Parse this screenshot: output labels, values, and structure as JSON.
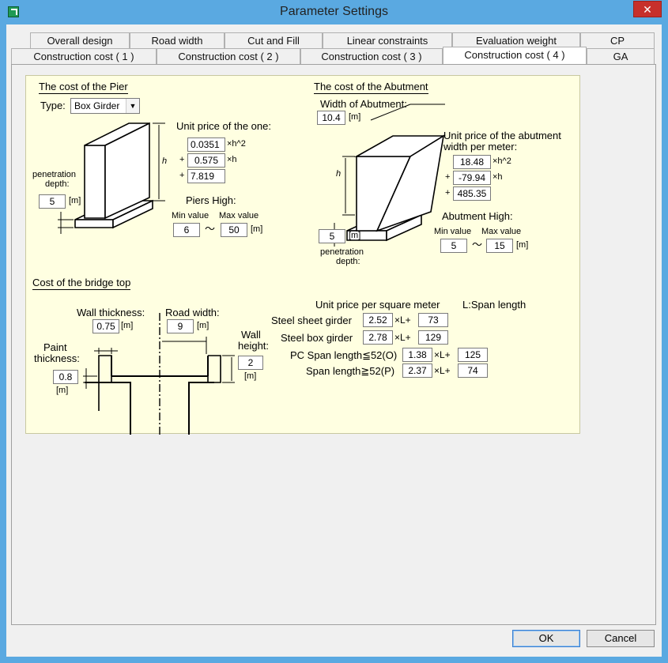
{
  "window": {
    "title": "Parameter Settings",
    "close_glyph": "✕"
  },
  "tabs_row1": [
    "Overall design",
    "Road width",
    "Cut and Fill",
    "Linear constraints",
    "Evaluation weight",
    "CP"
  ],
  "tabs_row2": [
    "Construction cost ( 1 )",
    "Construction cost ( 2 )",
    "Construction cost ( 3 )",
    "Construction cost ( 4 )",
    "GA"
  ],
  "active_tab": "Construction cost ( 4 )",
  "pier": {
    "heading": "The cost of the Pier",
    "type_label": "Type:",
    "type_value": "Box Girder",
    "unit_price_label": "Unit price of the one:",
    "coef": [
      "0.0351",
      "0.575",
      "7.819"
    ],
    "term1": "×h^2",
    "term2": "×h",
    "plus": "+",
    "h_label": "h",
    "penetration_label_1": "penetration",
    "penetration_label_2": "depth:",
    "penetration_value": "5",
    "unit_m": "[m]",
    "high_label": "Piers High:",
    "min_label": "Min value",
    "max_label": "Max value",
    "min_value": "6",
    "max_value": "50",
    "tilde": "〜"
  },
  "abutment": {
    "heading": "The cost of the Abutment",
    "width_label": "Width of Abutment:",
    "width_value": "10.4",
    "unit_price_label_1": "Unit price of the abutment",
    "unit_price_label_2": "width per meter:",
    "coef": [
      "18.48",
      "-79.94",
      "485.35"
    ],
    "penetration_value": "5",
    "penetration_label_1": "penetration",
    "penetration_label_2": "depth:",
    "high_label": "Abutment High:",
    "min_label": "Min value",
    "max_label": "Max value",
    "min_value": "5",
    "max_value": "15"
  },
  "bridge_top": {
    "heading": "Cost of the bridge top",
    "wall_thickness_label": "Wall thickness:",
    "wall_thickness_value": "0.75",
    "road_width_label": "Road width:",
    "road_width_value": "9",
    "wall_height_label_1": "Wall",
    "wall_height_label_2": "height:",
    "wall_height_value": "2",
    "paint_label_1": "Paint",
    "paint_label_2": "thickness:",
    "paint_value": "0.8",
    "unit_price_header": "Unit price per square meter",
    "span_note": "L:Span length",
    "rows": [
      {
        "label": "Steel sheet girder",
        "a": "2.52",
        "b": "73"
      },
      {
        "label": "Steel box girder",
        "a": "2.78",
        "b": "129"
      },
      {
        "label": "PC Span length≦52(O)",
        "a": "1.38",
        "b": "125"
      },
      {
        "label": "Span length≧52(P)",
        "a": "2.37",
        "b": "74"
      }
    ],
    "times_l_plus": "×L+"
  },
  "buttons": {
    "ok": "OK",
    "cancel": "Cancel"
  }
}
